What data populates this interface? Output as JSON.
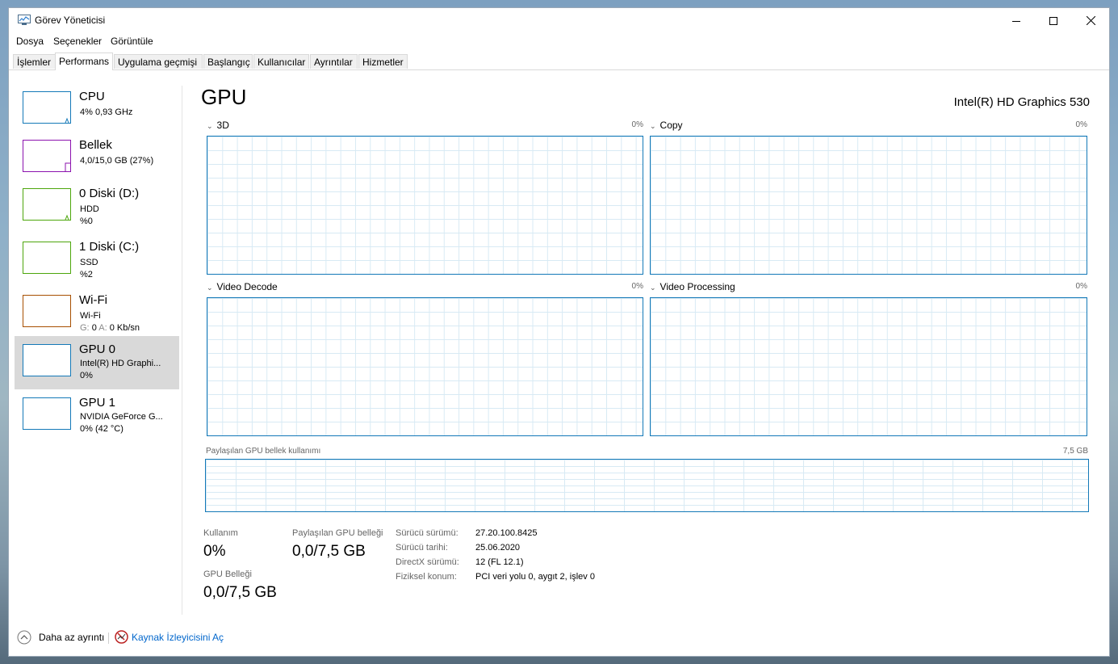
{
  "window": {
    "title": "Görev Yöneticisi",
    "minimize": "—",
    "maximize": "☐",
    "close": "✕"
  },
  "menu": [
    "Dosya",
    "Seçenekler",
    "Görüntüle"
  ],
  "tabs": [
    "İşlemler",
    "Performans",
    "Uygulama geçmişi",
    "Başlangıç",
    "Kullanıcılar",
    "Ayrıntılar",
    "Hizmetler"
  ],
  "active_tab": "Performans",
  "colors": {
    "cpu": "#1479b8",
    "memory": "#8b12ae",
    "disk": "#4da60c",
    "wifi": "#a74f01",
    "gpu": "#1479b8",
    "link": "#0066cc"
  },
  "sidebar": [
    {
      "title": "CPU",
      "line1": "4% 0,93 GHz",
      "line2": ""
    },
    {
      "title": "Bellek",
      "line1": "4,0/15,0 GB (27%)",
      "line2": ""
    },
    {
      "title": "0 Diski (D:)",
      "line1": "HDD",
      "line2": "%0"
    },
    {
      "title": "1 Diski (C:)",
      "line1": "SSD",
      "line2": "%2"
    },
    {
      "title": "Wi-Fi",
      "line1": "Wi-Fi",
      "line2_g": "G:",
      "line2_g_val": "0",
      "line2_a": "A:",
      "line2_a_val": "0 Kb/sn"
    },
    {
      "title": "GPU 0",
      "line1": "Intel(R) HD Graphi...",
      "line2": "0%"
    },
    {
      "title": "GPU 1",
      "line1": "NVIDIA GeForce G...",
      "line2": "0% (42 °C)"
    }
  ],
  "main": {
    "title": "GPU",
    "device": "Intel(R) HD Graphics 530",
    "graphs": [
      {
        "label": "3D",
        "percent": "0%"
      },
      {
        "label": "Copy",
        "percent": "0%"
      },
      {
        "label": "Video Decode",
        "percent": "0%"
      },
      {
        "label": "Video Processing",
        "percent": "0%"
      }
    ],
    "shared_memory_label": "Paylaşılan GPU bellek kullanımı",
    "shared_memory_max": "7,5 GB",
    "stats": {
      "usage_label": "Kullanım",
      "usage_value": "0%",
      "shared_label": "Paylaşılan GPU belleği",
      "shared_value": "0,0/7,5 GB",
      "gpu_mem_label": "GPU Belleği",
      "gpu_mem_value": "0,0/7,5 GB"
    },
    "details": [
      {
        "label": "Sürücü sürümü:",
        "value": "27.20.100.8425"
      },
      {
        "label": "Sürücü tarihi:",
        "value": "25.06.2020"
      },
      {
        "label": "DirectX sürümü:",
        "value": "12 (FL 12.1)"
      },
      {
        "label": "Fiziksel konum:",
        "value": "PCI veri yolu 0, aygıt 2, işlev 0"
      }
    ]
  },
  "footer": {
    "fewer_details": "Daha az ayrıntı",
    "resource_monitor": "Kaynak İzleyicisini Aç"
  }
}
